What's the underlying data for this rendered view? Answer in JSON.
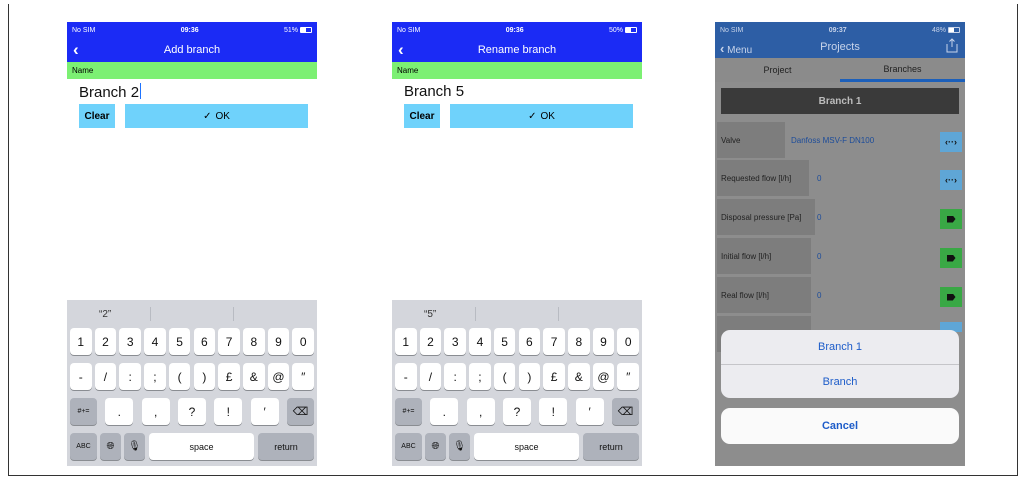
{
  "screens": [
    {
      "status": {
        "carrier": "No SIM",
        "time": "09:36",
        "battery": "51%"
      },
      "nav": {
        "title": "Add branch"
      },
      "name_label": "Name",
      "name_value": "Branch 2",
      "clear_label": "Clear",
      "ok_label": "OK",
      "suggestion": "“2”"
    },
    {
      "status": {
        "carrier": "No SIM",
        "time": "09:36",
        "battery": "50%"
      },
      "nav": {
        "title": "Rename branch"
      },
      "name_label": "Name",
      "name_value": "Branch 5",
      "clear_label": "Clear",
      "ok_label": "OK",
      "suggestion": "“5”"
    }
  ],
  "keyboard": {
    "row1": [
      "1",
      "2",
      "3",
      "4",
      "5",
      "6",
      "7",
      "8",
      "9",
      "0"
    ],
    "row2": [
      "-",
      "/",
      ":",
      ";",
      "(",
      ")",
      "£",
      "&",
      "@",
      "″"
    ],
    "row3_left": "#+=",
    "row3": [
      ".",
      ",",
      "?",
      "!",
      "′"
    ],
    "abc": "ABC",
    "space": "space",
    "return": "return"
  },
  "projects": {
    "status": {
      "carrier": "No SIM",
      "time": "09:37",
      "battery": "48%"
    },
    "back_label": "Menu",
    "title": "Projects",
    "tabs": [
      "Project",
      "Branches"
    ],
    "branch_header": "Branch 1",
    "rows": [
      {
        "label": "Valve",
        "value": "Danfoss MSV-F  DN100"
      },
      {
        "label": "Requested flow [l/h]",
        "value": "0"
      },
      {
        "label": "Disposal pressure [Pa]",
        "value": "0"
      },
      {
        "label": "Initial flow [l/h]",
        "value": "0"
      },
      {
        "label": "Real flow [l/h]",
        "value": "0"
      }
    ],
    "action_sheet": [
      "Branch 1",
      "Branch"
    ],
    "cancel_label": "Cancel"
  },
  "colors": {
    "nav_blue": "#1b2bf5",
    "name_green": "#7cf073",
    "button_cyan": "#6fd2fb",
    "projects_nav": "#2d5ea5",
    "icon_blue": "#5fa6d6",
    "icon_green": "#39a845"
  }
}
